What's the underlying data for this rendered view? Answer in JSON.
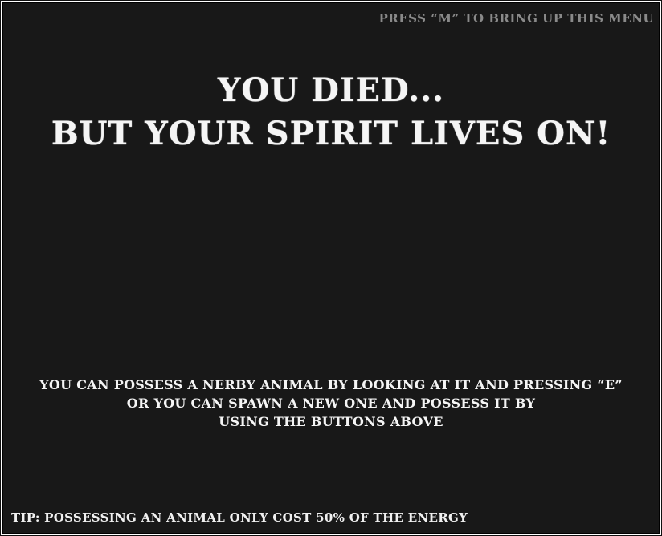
{
  "menu_hint": "PRESS “M” TO BRING UP THIS MENU",
  "title": {
    "line1": "YOU DIED...",
    "line2": "BUT YOUR SPIRIT LIVES ON!"
  },
  "instructions": {
    "line1": "YOU CAN POSSESS A NERBY ANIMAL BY LOOKING AT IT AND PRESSING “E”",
    "line2": "OR YOU CAN SPAWN A NEW ONE AND POSSESS IT BY",
    "line3": "USING THE BUTTONS ABOVE"
  },
  "tip": "TIP: POSSESSING AN ANIMAL ONLY COST 50% OF THE ENERGY",
  "colors": {
    "background": "#181818",
    "text": "#f5f5f5",
    "hint_text": "#8a8a8a"
  }
}
